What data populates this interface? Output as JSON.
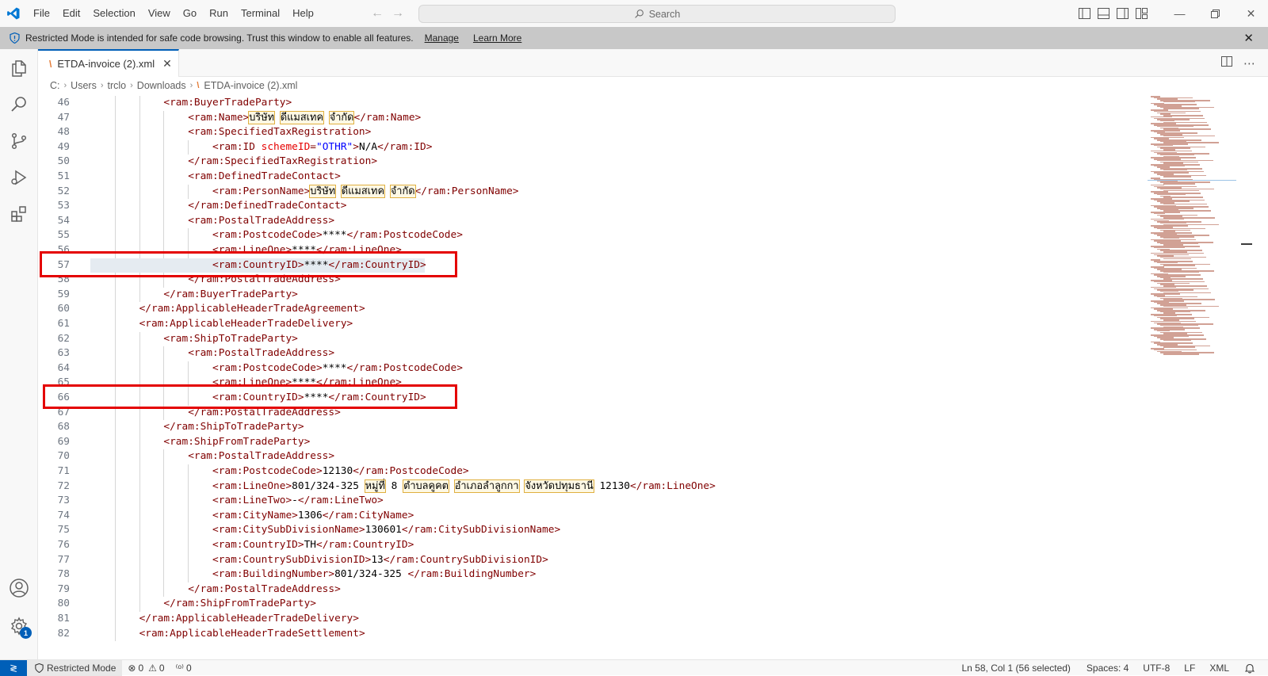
{
  "menu": [
    "File",
    "Edit",
    "Selection",
    "View",
    "Go",
    "Run",
    "Terminal",
    "Help"
  ],
  "search": {
    "label": "Search"
  },
  "banner": {
    "message": "Restricted Mode is intended for safe code browsing. Trust this window to enable all features.",
    "manage": "Manage",
    "learn_more": "Learn More"
  },
  "tab": {
    "label": "ETDA-invoice (2).xml"
  },
  "breadcrumb": [
    "C:",
    "Users",
    "trclo",
    "Downloads",
    "ETDA-invoice (2).xml"
  ],
  "editor": {
    "lines": [
      {
        "n": "46",
        "indent": 3,
        "parts": [
          [
            "tag",
            "<ram:BuyerTradeParty>"
          ]
        ]
      },
      {
        "n": "47",
        "indent": 4,
        "parts": [
          [
            "tag",
            "<ram:Name>"
          ],
          [
            "thai",
            "บริษัท"
          ],
          [
            "txt",
            " "
          ],
          [
            "thai",
            "ดีแมสเทค"
          ],
          [
            "txt",
            " "
          ],
          [
            "thai",
            "จำกัด"
          ],
          [
            "tag",
            "</ram:Name>"
          ]
        ]
      },
      {
        "n": "48",
        "indent": 4,
        "parts": [
          [
            "tag",
            "<ram:SpecifiedTaxRegistration>"
          ]
        ]
      },
      {
        "n": "49",
        "indent": 5,
        "parts": [
          [
            "tag",
            "<ram:ID "
          ],
          [
            "attr",
            "schemeID"
          ],
          [
            "tag",
            "="
          ],
          [
            "str",
            "\"OTHR\""
          ],
          [
            "tag",
            ">"
          ],
          [
            "txt",
            "N/A"
          ],
          [
            "tag",
            "</ram:ID>"
          ]
        ]
      },
      {
        "n": "50",
        "indent": 4,
        "parts": [
          [
            "tag",
            "</ram:SpecifiedTaxRegistration>"
          ]
        ]
      },
      {
        "n": "51",
        "indent": 4,
        "parts": [
          [
            "tag",
            "<ram:DefinedTradeContact>"
          ]
        ]
      },
      {
        "n": "52",
        "indent": 5,
        "parts": [
          [
            "tag",
            "<ram:PersonName>"
          ],
          [
            "thai",
            "บริษัท"
          ],
          [
            "txt",
            " "
          ],
          [
            "thai",
            "ดีแมสเทค"
          ],
          [
            "txt",
            " "
          ],
          [
            "thai",
            "จำกัด"
          ],
          [
            "tag",
            "</ram:PersonName>"
          ]
        ]
      },
      {
        "n": "53",
        "indent": 4,
        "parts": [
          [
            "tag",
            "</ram:DefinedTradeContact>"
          ]
        ]
      },
      {
        "n": "54",
        "indent": 4,
        "parts": [
          [
            "tag",
            "<ram:PostalTradeAddress>"
          ]
        ]
      },
      {
        "n": "55",
        "indent": 5,
        "parts": [
          [
            "tag",
            "<ram:PostcodeCode>"
          ],
          [
            "txt",
            "****"
          ],
          [
            "tag",
            "</ram:PostcodeCode>"
          ]
        ]
      },
      {
        "n": "56",
        "indent": 5,
        "parts": [
          [
            "tag",
            "<ram:LineOne>"
          ],
          [
            "txt",
            "****"
          ],
          [
            "tag",
            "</ram:LineOne>"
          ]
        ]
      },
      {
        "n": "57",
        "indent": 5,
        "selected": true,
        "parts": [
          [
            "tag",
            "<ram:CountryID>"
          ],
          [
            "txt",
            "****"
          ],
          [
            "tag",
            "</ram:CountryID>"
          ]
        ]
      },
      {
        "n": "58",
        "indent": 4,
        "parts": [
          [
            "tag",
            "</ram:PostalTradeAddress>"
          ]
        ]
      },
      {
        "n": "59",
        "indent": 3,
        "parts": [
          [
            "tag",
            "</ram:BuyerTradeParty>"
          ]
        ]
      },
      {
        "n": "60",
        "indent": 2,
        "parts": [
          [
            "tag",
            "</ram:ApplicableHeaderTradeAgreement>"
          ]
        ]
      },
      {
        "n": "61",
        "indent": 2,
        "parts": [
          [
            "tag",
            "<ram:ApplicableHeaderTradeDelivery>"
          ]
        ]
      },
      {
        "n": "62",
        "indent": 3,
        "parts": [
          [
            "tag",
            "<ram:ShipToTradeParty>"
          ]
        ]
      },
      {
        "n": "63",
        "indent": 4,
        "parts": [
          [
            "tag",
            "<ram:PostalTradeAddress>"
          ]
        ]
      },
      {
        "n": "64",
        "indent": 5,
        "parts": [
          [
            "tag",
            "<ram:PostcodeCode>"
          ],
          [
            "txt",
            "****"
          ],
          [
            "tag",
            "</ram:PostcodeCode>"
          ]
        ]
      },
      {
        "n": "65",
        "indent": 5,
        "parts": [
          [
            "tag",
            "<ram:LineOne>"
          ],
          [
            "txt",
            "****"
          ],
          [
            "tag",
            "</ram:LineOne>"
          ]
        ]
      },
      {
        "n": "66",
        "indent": 5,
        "parts": [
          [
            "tag",
            "<ram:CountryID>"
          ],
          [
            "txt",
            "****"
          ],
          [
            "tag",
            "</ram:CountryID>"
          ]
        ]
      },
      {
        "n": "67",
        "indent": 4,
        "parts": [
          [
            "tag",
            "</ram:PostalTradeAddress>"
          ]
        ]
      },
      {
        "n": "68",
        "indent": 3,
        "parts": [
          [
            "tag",
            "</ram:ShipToTradeParty>"
          ]
        ]
      },
      {
        "n": "69",
        "indent": 3,
        "parts": [
          [
            "tag",
            "<ram:ShipFromTradeParty>"
          ]
        ]
      },
      {
        "n": "70",
        "indent": 4,
        "parts": [
          [
            "tag",
            "<ram:PostalTradeAddress>"
          ]
        ]
      },
      {
        "n": "71",
        "indent": 5,
        "parts": [
          [
            "tag",
            "<ram:PostcodeCode>"
          ],
          [
            "txt",
            "12130"
          ],
          [
            "tag",
            "</ram:PostcodeCode>"
          ]
        ]
      },
      {
        "n": "72",
        "indent": 5,
        "parts": [
          [
            "tag",
            "<ram:LineOne>"
          ],
          [
            "txt",
            "801/324-325 "
          ],
          [
            "thai",
            "หมู่ที่"
          ],
          [
            "txt",
            " 8 "
          ],
          [
            "thai",
            "ตำบลคูคต"
          ],
          [
            "txt",
            " "
          ],
          [
            "thai",
            "อำเภอลำลูกกา"
          ],
          [
            "txt",
            " "
          ],
          [
            "thai",
            "จังหวัดปทุมธานี"
          ],
          [
            "txt",
            " 12130"
          ],
          [
            "tag",
            "</ram:LineOne>"
          ]
        ]
      },
      {
        "n": "73",
        "indent": 5,
        "parts": [
          [
            "tag",
            "<ram:LineTwo>"
          ],
          [
            "txt",
            "-"
          ],
          [
            "tag",
            "</ram:LineTwo>"
          ]
        ]
      },
      {
        "n": "74",
        "indent": 5,
        "parts": [
          [
            "tag",
            "<ram:CityName>"
          ],
          [
            "txt",
            "1306"
          ],
          [
            "tag",
            "</ram:CityName>"
          ]
        ]
      },
      {
        "n": "75",
        "indent": 5,
        "parts": [
          [
            "tag",
            "<ram:CitySubDivisionName>"
          ],
          [
            "txt",
            "130601"
          ],
          [
            "tag",
            "</ram:CitySubDivisionName>"
          ]
        ]
      },
      {
        "n": "76",
        "indent": 5,
        "parts": [
          [
            "tag",
            "<ram:CountryID>"
          ],
          [
            "txt",
            "TH"
          ],
          [
            "tag",
            "</ram:CountryID>"
          ]
        ]
      },
      {
        "n": "77",
        "indent": 5,
        "parts": [
          [
            "tag",
            "<ram:CountrySubDivisionID>"
          ],
          [
            "txt",
            "13"
          ],
          [
            "tag",
            "</ram:CountrySubDivisionID>"
          ]
        ]
      },
      {
        "n": "78",
        "indent": 5,
        "parts": [
          [
            "tag",
            "<ram:BuildingNumber>"
          ],
          [
            "txt",
            "801/324-325 "
          ],
          [
            "tag",
            "</ram:BuildingNumber>"
          ]
        ]
      },
      {
        "n": "79",
        "indent": 4,
        "parts": [
          [
            "tag",
            "</ram:PostalTradeAddress>"
          ]
        ]
      },
      {
        "n": "80",
        "indent": 3,
        "parts": [
          [
            "tag",
            "</ram:ShipFromTradeParty>"
          ]
        ]
      },
      {
        "n": "81",
        "indent": 2,
        "parts": [
          [
            "tag",
            "</ram:ApplicableHeaderTradeDelivery>"
          ]
        ]
      },
      {
        "n": "82",
        "indent": 2,
        "parts": [
          [
            "tag",
            "<ram:ApplicableHeaderTradeSettlement>"
          ]
        ]
      }
    ]
  },
  "activity": {
    "settings_badge": "1"
  },
  "status": {
    "restricted": "Restricted Mode",
    "errors": "0",
    "warnings": "0",
    "ports": "0",
    "position": "Ln 58, Col 1 (56 selected)",
    "spaces": "Spaces: 4",
    "encoding": "UTF-8",
    "eol": "LF",
    "language": "XML"
  },
  "colors": {
    "accent": "#005fb8",
    "annotation_red": "#e40000",
    "tag": "#800000",
    "attr": "#e50000",
    "string": "#0000ff"
  }
}
